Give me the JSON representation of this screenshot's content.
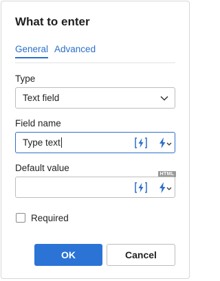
{
  "dialog": {
    "title": "What to enter",
    "tabs": [
      {
        "label": "General",
        "active": true
      },
      {
        "label": "Advanced",
        "active": false
      }
    ]
  },
  "type_field": {
    "label": "Type",
    "value": "Text field"
  },
  "name_field": {
    "label": "Field name",
    "value": "Type text"
  },
  "default_field": {
    "label": "Default value",
    "value": "",
    "badge": "HTML"
  },
  "required": {
    "label": "Required",
    "checked": false
  },
  "buttons": {
    "ok": "OK",
    "cancel": "Cancel"
  },
  "colors": {
    "accent": "#2b74d6",
    "link": "#2b6fc8",
    "border": "#bcbcbc"
  },
  "icons": [
    "insert-field-icon",
    "lightning-dropdown-icon",
    "chevron-down-icon"
  ]
}
